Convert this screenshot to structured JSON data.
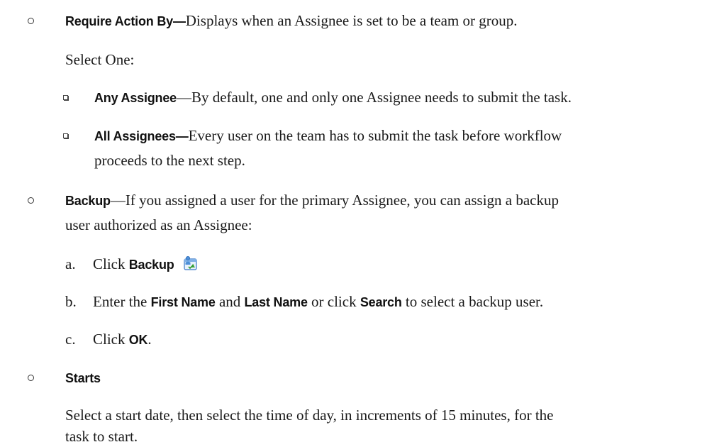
{
  "items": {
    "require_action": {
      "title": "Require Action By—",
      "desc": "Displays when an Assignee is set to be a team or group.",
      "select_one": "Select One:",
      "options": [
        {
          "title": "Any Assignee",
          "sep": "—",
          "desc": "By default, one and only one Assignee needs to submit the task."
        },
        {
          "title": "All Assignees—",
          "desc_line1": "Every user on the team has to submit the task before workflow",
          "desc_line2": "proceeds to the next step."
        }
      ]
    },
    "backup": {
      "title": "Backup",
      "sep": "—",
      "desc_line1": "If you assigned a user for the primary Assignee, you can assign a backup",
      "desc_line2": "user authorized as an Assignee:",
      "steps": [
        {
          "marker": "a.",
          "t1": "Click ",
          "b1": "Backup",
          "icon": "backup-user-icon"
        },
        {
          "marker": "b.",
          "t1": "Enter the ",
          "b1": "First Name",
          "t2": " and ",
          "b2": "Last Name",
          "t3": " or click ",
          "b3": "Search",
          "t4": " to select a backup user."
        },
        {
          "marker": "c.",
          "t1": "Click ",
          "b1": "OK",
          "t2": "."
        }
      ]
    },
    "starts": {
      "title": "Starts",
      "desc_line1": "Select a start date, then select the time of day, in increments of 15 minutes, for the",
      "desc_line2": "task to start."
    }
  }
}
